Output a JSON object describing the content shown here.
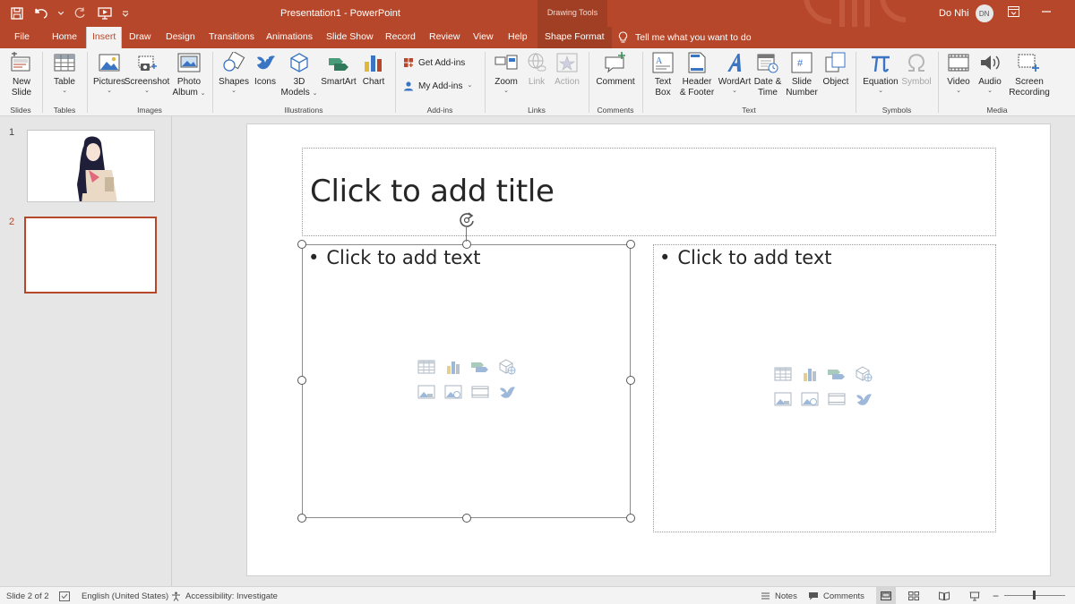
{
  "window": {
    "title": "Presentation1  -  PowerPoint",
    "context_group": "Drawing Tools",
    "user_name": "Do Nhi",
    "user_initials": "DN",
    "accent": "#b7472a"
  },
  "quick_access": {
    "icons": [
      "save-icon",
      "undo-icon",
      "redo-icon",
      "present-from-start-icon",
      "customize-icon"
    ]
  },
  "tabs": [
    {
      "label": "File"
    },
    {
      "label": "Home"
    },
    {
      "label": "Insert",
      "active": true
    },
    {
      "label": "Draw"
    },
    {
      "label": "Design"
    },
    {
      "label": "Transitions"
    },
    {
      "label": "Animations"
    },
    {
      "label": "Slide Show"
    },
    {
      "label": "Record"
    },
    {
      "label": "Review"
    },
    {
      "label": "View"
    },
    {
      "label": "Help"
    },
    {
      "label": "Shape Format",
      "contextual": true
    }
  ],
  "tell_me": "Tell me what you want to do",
  "ribbon": {
    "groups": {
      "slides": "Slides",
      "tables": "Tables",
      "images": "Images",
      "illustrations": "Illustrations",
      "addins": "Add-ins",
      "links": "Links",
      "comments": "Comments",
      "text": "Text",
      "symbols": "Symbols",
      "media": "Media"
    },
    "buttons": {
      "new_slide_1": "New",
      "new_slide_2": "Slide",
      "table": "Table",
      "pictures": "Pictures",
      "screenshot": "Screenshot",
      "photo_album_1": "Photo",
      "photo_album_2": "Album",
      "shapes": "Shapes",
      "icons": "Icons",
      "models_1": "3D",
      "models_2": "Models",
      "smartart": "SmartArt",
      "chart": "Chart",
      "get_addins": "Get Add-ins",
      "my_addins": "My Add-ins",
      "zoom": "Zoom",
      "link": "Link",
      "action": "Action",
      "comment": "Comment",
      "text_box_1": "Text",
      "text_box_2": "Box",
      "header_footer_1": "Header",
      "header_footer_2": "& Footer",
      "wordart": "WordArt",
      "date_time_1": "Date &",
      "date_time_2": "Time",
      "slide_number_1": "Slide",
      "slide_number_2": "Number",
      "object": "Object",
      "equation": "Equation",
      "symbol": "Symbol",
      "video": "Video",
      "audio": "Audio",
      "screen_recording_1": "Screen",
      "screen_recording_2": "Recording"
    }
  },
  "thumbnails": [
    {
      "number": "1"
    },
    {
      "number": "2",
      "selected": true
    }
  ],
  "slide": {
    "title_placeholder": "Click to add title",
    "left_placeholder": "Click to add text",
    "right_placeholder": "Click to add text"
  },
  "status": {
    "slide_info": "Slide 2 of 2",
    "language": "English (United States)",
    "accessibility": "Accessibility: Investigate",
    "notes": "Notes",
    "comments": "Comments"
  }
}
